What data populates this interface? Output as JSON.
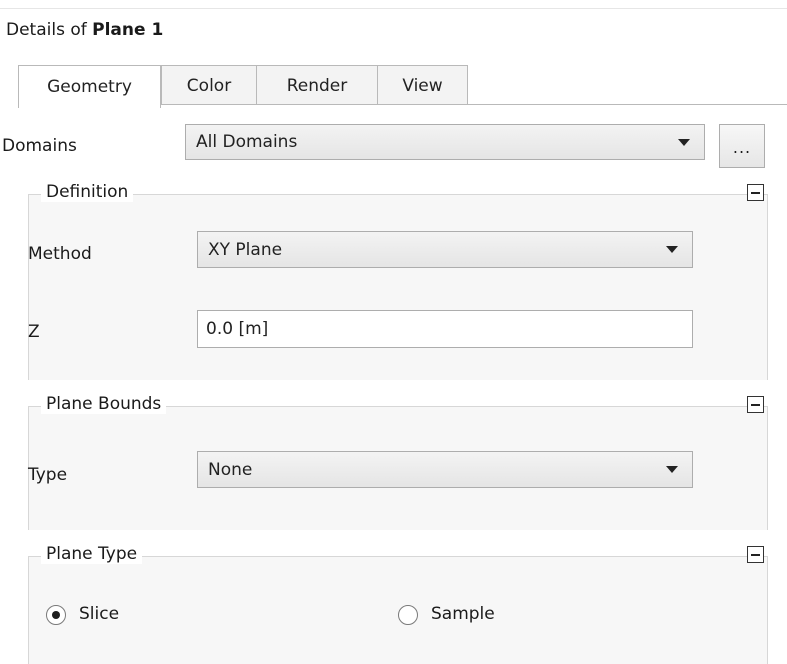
{
  "panel": {
    "title_prefix": "Details of",
    "title_object": "Plane 1"
  },
  "tabs": [
    {
      "label": "Geometry",
      "active": true
    },
    {
      "label": "Color",
      "active": false
    },
    {
      "label": "Render",
      "active": false
    },
    {
      "label": "View",
      "active": false
    }
  ],
  "domains": {
    "label": "Domains",
    "value": "All Domains",
    "more_button": "..."
  },
  "definition": {
    "title": "Definition",
    "method_label": "Method",
    "method_value": "XY Plane",
    "z_label": "Z",
    "z_value": "0.0 [m]"
  },
  "plane_bounds": {
    "title": "Plane Bounds",
    "type_label": "Type",
    "type_value": "None"
  },
  "plane_type": {
    "title": "Plane Type",
    "options": [
      {
        "label": "Slice",
        "selected": true
      },
      {
        "label": "Sample",
        "selected": false
      }
    ]
  },
  "icons": {
    "collapse": "collapse-minus-icon",
    "dropdown": "dropdown-arrow-icon"
  }
}
